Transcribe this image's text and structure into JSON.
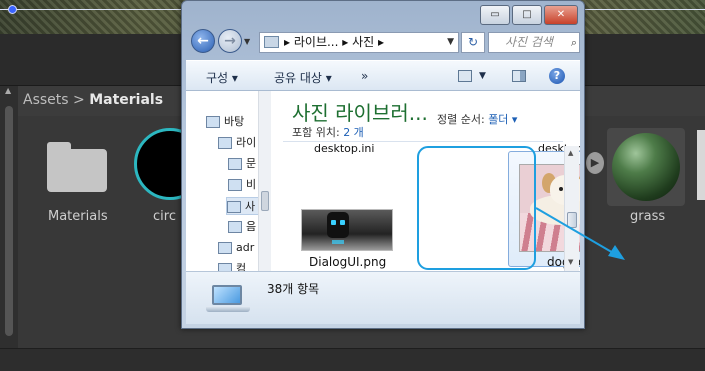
{
  "background_editor": {
    "breadcrumb": {
      "root": "Assets",
      "separator": ">",
      "current": "Materials"
    },
    "assets": [
      {
        "label": "Materials",
        "kind": "folder"
      },
      {
        "label": "circ",
        "kind": "material-circle"
      },
      {
        "label": "grass",
        "kind": "material-sphere"
      }
    ],
    "colors": {
      "accent": "#2cb7c0",
      "pointer_arrow": "#1e9fe0"
    }
  },
  "explorer": {
    "window_controls": {
      "minimize": "▭",
      "maximize": "□",
      "close": "✕"
    },
    "address": {
      "root_sep": "▸",
      "segment1": "라이브...",
      "segment2": "사진",
      "trail_sep": "▸"
    },
    "search_placeholder": "사진 검색",
    "toolbar": {
      "organize": "구성 ▾",
      "share": "공유 대상 ▾",
      "more": "»"
    },
    "nav_items": [
      {
        "label": "바탕",
        "icon": "desktop-icon"
      },
      {
        "label": "라이",
        "icon": "library-icon"
      },
      {
        "label": "문",
        "icon": "document-icon"
      },
      {
        "label": "비",
        "icon": "video-icon"
      },
      {
        "label": "사",
        "icon": "picture-icon",
        "selected": true
      },
      {
        "label": "음",
        "icon": "music-icon"
      },
      {
        "label": "adr",
        "icon": "user-icon"
      },
      {
        "label": "컴",
        "icon": "computer-icon"
      }
    ],
    "library": {
      "title": "사진 라이브러...",
      "includes_label": "포함 위치:",
      "includes_value": "2 개",
      "sort_label": "정렬 순서:",
      "sort_value": "폴더 ▾"
    },
    "files": [
      {
        "name": "desktop.ini",
        "partial": true
      },
      {
        "name": "desktop.ini",
        "partial": true
      },
      {
        "name": "DialogUI.png"
      },
      {
        "name": "dog.png",
        "selected": true
      }
    ],
    "status": {
      "item_count": "38개 항목"
    }
  }
}
